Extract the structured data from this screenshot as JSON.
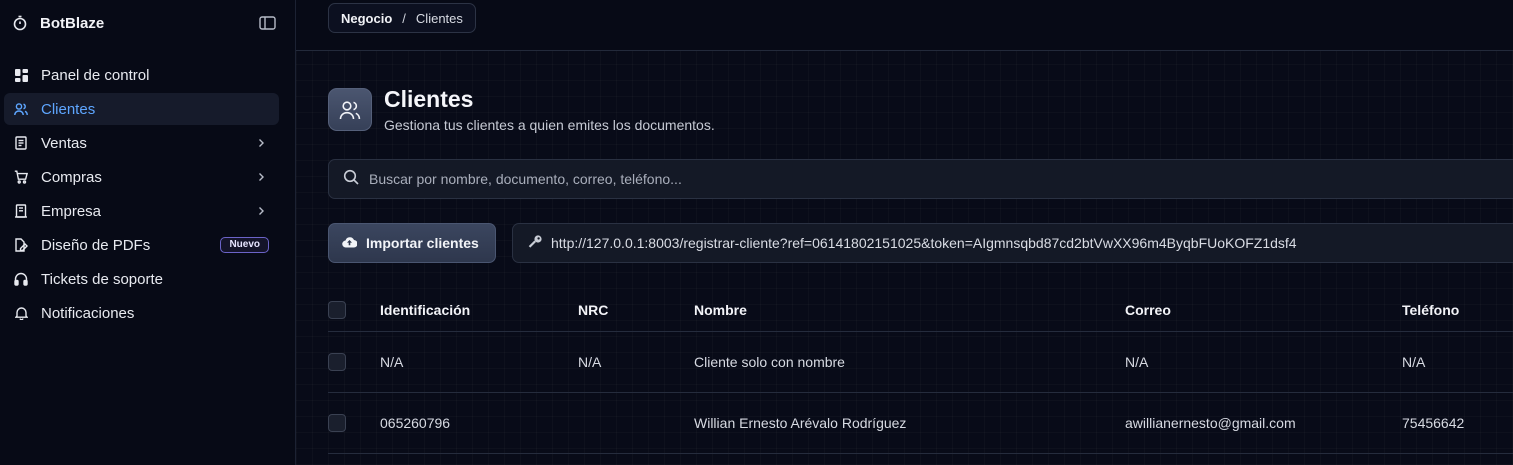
{
  "app": {
    "name": "BotBlaze"
  },
  "sidebar": {
    "items": [
      {
        "label": "Panel de control",
        "icon": "dashboard-icon"
      },
      {
        "label": "Clientes",
        "icon": "users-icon",
        "active": true
      },
      {
        "label": "Ventas",
        "icon": "receipt-icon",
        "has_submenu": true
      },
      {
        "label": "Compras",
        "icon": "cart-icon",
        "has_submenu": true
      },
      {
        "label": "Empresa",
        "icon": "building-icon",
        "has_submenu": true
      },
      {
        "label": "Diseño de PDFs",
        "icon": "file-design-icon",
        "badge": "Nuevo"
      },
      {
        "label": "Tickets de soporte",
        "icon": "headphones-icon"
      },
      {
        "label": "Notificaciones",
        "icon": "bell-icon"
      }
    ]
  },
  "breadcrumb": {
    "parent": "Negocio",
    "separator": "/",
    "current": "Clientes"
  },
  "page": {
    "title": "Clientes",
    "subtitle": "Gestiona tus clientes a quien emites los documentos."
  },
  "search": {
    "placeholder": "Buscar por nombre, documento, correo, teléfono...",
    "value": ""
  },
  "actions": {
    "import_label": "Importar clientes"
  },
  "registration_link": {
    "url": "http://127.0.0.1:8003/registrar-cliente?ref=06141802151025&token=AIgmnsqbd87cd2btVwXX96m4ByqbFUoKOFZ1dsf4"
  },
  "table": {
    "columns": [
      "Identificación",
      "NRC",
      "Nombre",
      "Correo",
      "Teléfono"
    ],
    "rows": [
      {
        "identificacion": "N/A",
        "nrc": "N/A",
        "nombre": "Cliente solo con nombre",
        "correo": "N/A",
        "telefono": "N/A"
      },
      {
        "identificacion": "065260796",
        "nrc": "",
        "nombre": "Willian Ernesto Arévalo Rodríguez",
        "correo": "awillianernesto@gmail.com",
        "telefono": "75456642"
      }
    ]
  },
  "colors": {
    "background": "#070a16",
    "accent": "#5ea6ff",
    "active_item_bg": "#161b2b",
    "badge_border": "#6b63c8"
  }
}
